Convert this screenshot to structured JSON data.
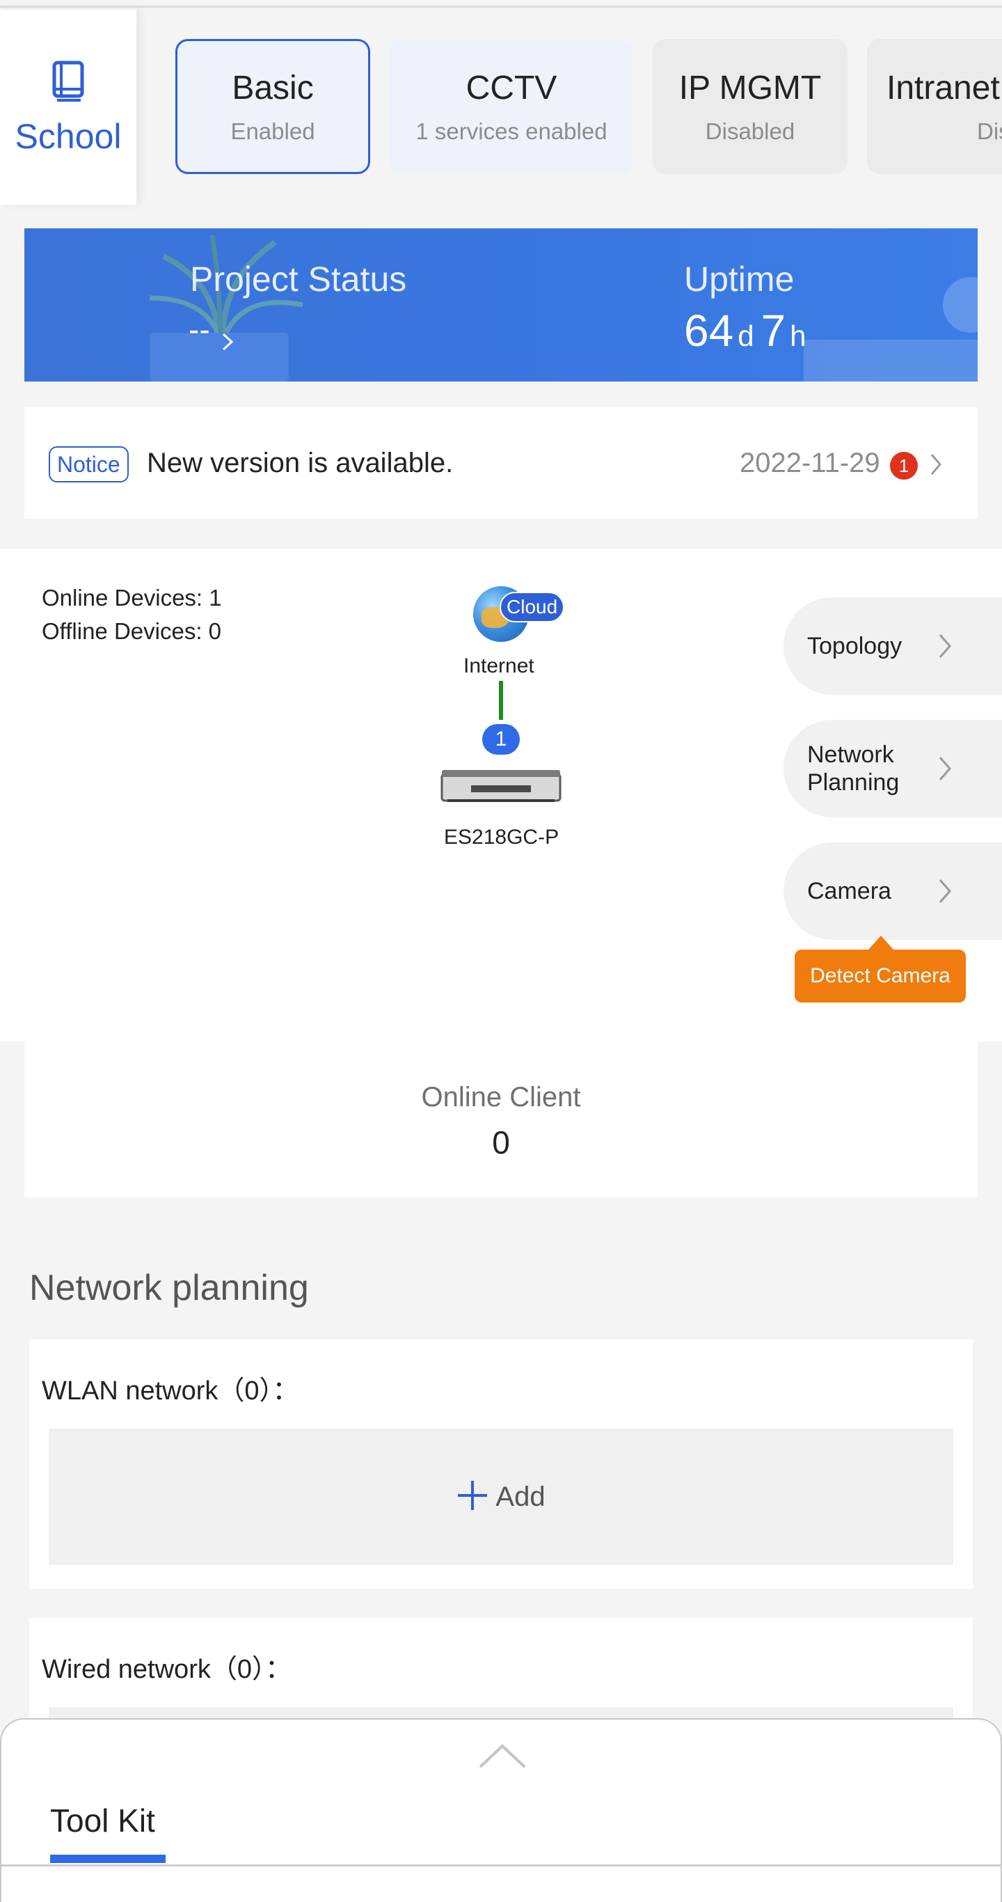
{
  "project": {
    "name": "School"
  },
  "scenes": [
    {
      "name": "Basic",
      "status": "Enabled"
    },
    {
      "name": "CCTV",
      "status": "1 services enabled"
    },
    {
      "name": "IP MGMT",
      "status": "Disabled"
    },
    {
      "name": "Intranet",
      "status": "Disa"
    }
  ],
  "banner": {
    "project_status_label": "Project Status",
    "project_status_value": "--",
    "uptime_label": "Uptime",
    "uptime_days": "64",
    "uptime_days_unit": "d",
    "uptime_hours": "7",
    "uptime_hours_unit": "h"
  },
  "notice": {
    "tag": "Notice",
    "text": "New version is available.",
    "date": "2022-11-29",
    "badge": "1"
  },
  "devices": {
    "online": "Online Devices: 1",
    "offline": "Offline Devices: 0",
    "internet_chip": "Cloud",
    "internet_label": "Internet",
    "link_count": "1",
    "switch_label": "ES218GC-P"
  },
  "side_menu": {
    "topology": "Topology",
    "network_planning_line1": "Network",
    "network_planning_line2": "Planning",
    "camera": "Camera",
    "detect_camera": "Detect Camera"
  },
  "client": {
    "title": "Online Client",
    "value": "0"
  },
  "network_planning": {
    "title": "Network planning",
    "wlan_title": "WLAN network（0）：",
    "add_label": "Add",
    "wired_title": "Wired network（0）："
  },
  "toolkit": {
    "tab": "Tool Kit"
  },
  "colors": {
    "accent": "#2f5fd6",
    "banner": "#3a77e0",
    "notice_badge": "#e0321f",
    "detect_camera": "#f07c0e",
    "link_line": "#1e8c1e"
  }
}
